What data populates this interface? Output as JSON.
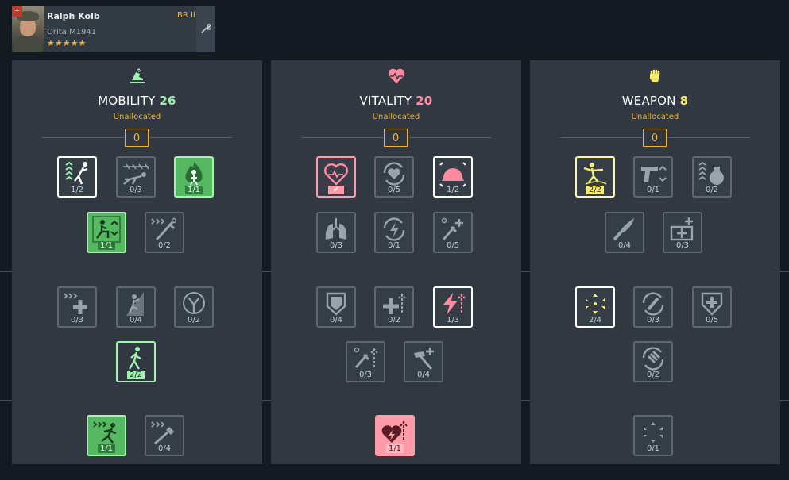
{
  "soldier": {
    "name": "Ralph Kolb",
    "br": "BR II",
    "unit": "Orita M1941",
    "stars": "★★★★★"
  },
  "categories": [
    {
      "title": "MOBILITY",
      "points": "26",
      "status": "Unallocated",
      "allocated": "0",
      "accent": "#9ff0b0"
    },
    {
      "title": "VITALITY",
      "points": "20",
      "status": "Unallocated",
      "allocated": "0",
      "accent": "#ff8aa0"
    },
    {
      "title": "WEAPON",
      "points": "8",
      "status": "Unallocated",
      "allocated": "0",
      "accent": "#f6eb6e"
    }
  ],
  "skills": {
    "mobility": [
      {
        "name": "vault",
        "level": "1/2"
      },
      {
        "name": "crawl",
        "level": "0/3"
      },
      {
        "name": "fire-resist",
        "level": "1/1"
      },
      {
        "name": "crouch-speed",
        "level": "1/1"
      },
      {
        "name": "quick-inject",
        "level": "0/2"
      },
      {
        "name": "fast-heal",
        "level": "0/3"
      },
      {
        "name": "climb",
        "level": "0/4"
      },
      {
        "name": "stamina",
        "level": "0/2"
      },
      {
        "name": "sprint",
        "level": "2/2"
      },
      {
        "name": "run-speed",
        "level": "1/1"
      },
      {
        "name": "fast-build",
        "level": "0/4"
      }
    ],
    "vitality": [
      {
        "name": "heal",
        "level": ""
      },
      {
        "name": "recovery",
        "level": "0/5"
      },
      {
        "name": "helmet",
        "level": "1/2"
      },
      {
        "name": "lungs",
        "level": "0/3"
      },
      {
        "name": "stun-recovery",
        "level": "0/1"
      },
      {
        "name": "syringe-plus",
        "level": "0/5"
      },
      {
        "name": "armor",
        "level": "0/4"
      },
      {
        "name": "medkit-up",
        "level": "0/2"
      },
      {
        "name": "energy-up",
        "level": "1/3"
      },
      {
        "name": "syringe-up",
        "level": "0/3"
      },
      {
        "name": "hammer-plus",
        "level": "0/4"
      },
      {
        "name": "heart-up",
        "level": "1/1"
      }
    ],
    "weapon": [
      {
        "name": "throw",
        "level": "2/2"
      },
      {
        "name": "pistol",
        "level": "0/1"
      },
      {
        "name": "grenade",
        "level": "0/2"
      },
      {
        "name": "knife",
        "level": "0/4"
      },
      {
        "name": "ammo-crate",
        "level": "0/3"
      },
      {
        "name": "aim",
        "level": "2/4"
      },
      {
        "name": "reload",
        "level": "0/3"
      },
      {
        "name": "shield-medic",
        "level": "0/5"
      },
      {
        "name": "ammo-swap",
        "level": "0/2"
      },
      {
        "name": "focus",
        "level": "0/1"
      }
    ]
  }
}
